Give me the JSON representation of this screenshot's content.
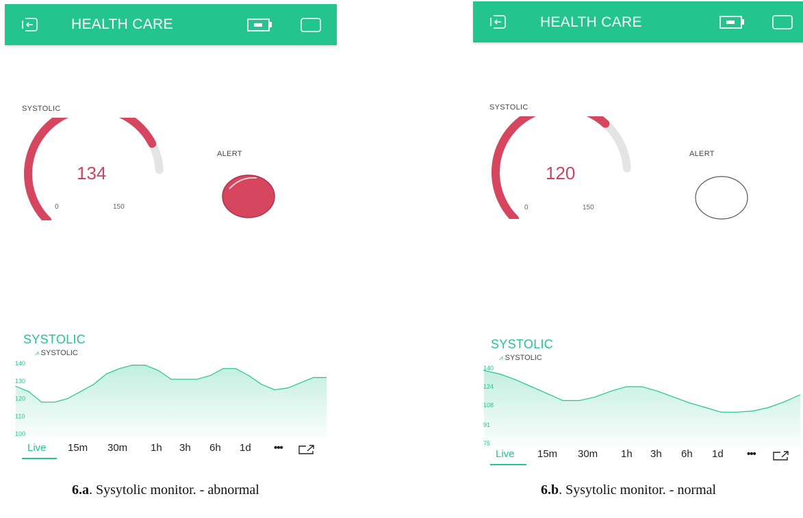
{
  "colors": {
    "accent": "#23c48e",
    "gauge": "#d6475f",
    "track": "#e4e4e4"
  },
  "panels": [
    {
      "title": "HEALTH CARE",
      "icons": [
        "exit-icon",
        "battery-icon",
        "square-icon"
      ],
      "gauge": {
        "label": "SYSTOLIC",
        "value": "134",
        "min": "0",
        "max": "150",
        "fraction": 0.893
      },
      "alert": {
        "label": "ALERT",
        "state": "on"
      },
      "chart_title": "SYSTOLIC",
      "legend": "SYSTOLIC",
      "yticks": [
        "140",
        "130",
        "120",
        "110",
        "100"
      ],
      "tabs": [
        "Live",
        "15m",
        "30m",
        "1h",
        "3h",
        "6h",
        "1d",
        "•••"
      ],
      "caption_bold": "6.a",
      "caption_rest": ". Sysytolic monitor. - abnormal"
    },
    {
      "title": "HEALTH CARE",
      "icons": [
        "exit-icon",
        "battery-icon",
        "square-icon"
      ],
      "gauge": {
        "label": "SYSTOLIC",
        "value": "120",
        "min": "0",
        "max": "150",
        "fraction": 0.8
      },
      "alert": {
        "label": "ALERT",
        "state": "off"
      },
      "chart_title": "SYSTOLIC",
      "legend": "SYSTOLIC",
      "yticks": [
        "140",
        "124",
        "108",
        "91",
        "75"
      ],
      "tabs": [
        "Live",
        "15m",
        "30m",
        "1h",
        "3h",
        "6h",
        "1d",
        "•••"
      ],
      "caption_bold": "6.b",
      "caption_rest": ". Sysytolic monitor. - normal"
    }
  ],
  "chart_data": [
    {
      "type": "area",
      "title": "SYSTOLIC",
      "series": [
        {
          "name": "SYSTOLIC",
          "values": [
            127,
            124,
            118,
            118,
            120,
            124,
            128,
            134,
            137,
            139,
            139,
            136,
            131,
            131,
            131,
            133,
            137,
            137,
            133,
            128,
            125,
            126,
            129,
            132,
            132
          ]
        }
      ],
      "ylim": [
        100,
        140
      ],
      "yticks": [
        140,
        130,
        120,
        110,
        100
      ]
    },
    {
      "type": "area",
      "title": "SYSTOLIC",
      "series": [
        {
          "name": "SYSTOLIC",
          "values": [
            138,
            135,
            130,
            124,
            118,
            112,
            112,
            115,
            120,
            124,
            124,
            120,
            115,
            110,
            106,
            102,
            102,
            103,
            106,
            111,
            117
          ]
        }
      ],
      "ylim": [
        75,
        140
      ],
      "yticks": [
        140,
        124,
        108,
        91,
        75
      ]
    }
  ]
}
